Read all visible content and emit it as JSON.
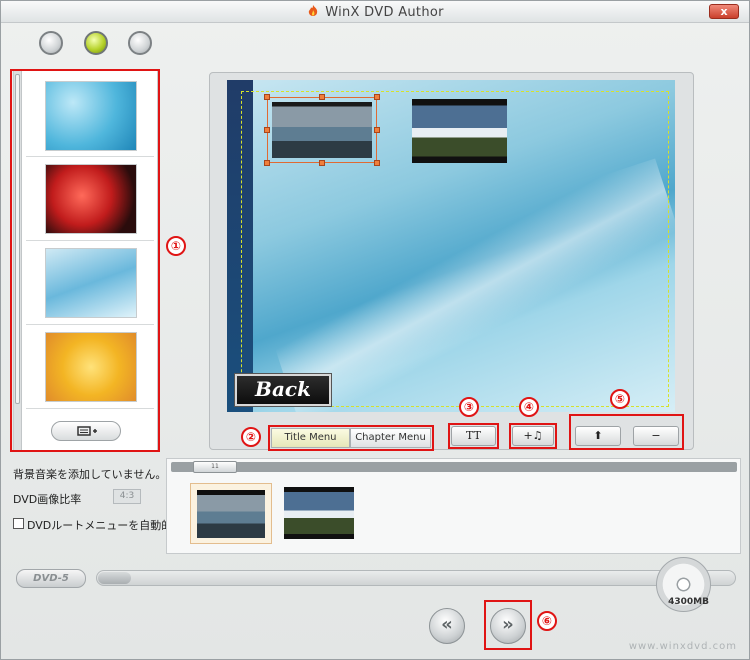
{
  "window": {
    "title": "WinX DVD Author",
    "close_label": "x"
  },
  "top_buttons": [
    "step-1",
    "step-2",
    "step-3"
  ],
  "template_panel": {
    "add_button_icon": "add-menu-icon",
    "thumbnails": [
      "blue-bubbles",
      "red-roses",
      "blue-wave",
      "yellow-flowers"
    ]
  },
  "preview": {
    "back_label": "Back"
  },
  "menu_tabs": [
    {
      "label": "Title Menu",
      "active": true
    },
    {
      "label": "Chapter Menu",
      "active": false
    }
  ],
  "tools": {
    "text_label": "TT",
    "music_label": "+♫",
    "up_label": "⬆",
    "minus_label": "−"
  },
  "info": {
    "music_status": "背景音楽を添加していません。",
    "ratio_label": "DVD画像比率",
    "ratio_value": "4:3",
    "auto_menu_label": "DVDルートメニューを自動的に添加する"
  },
  "timeline": {
    "thumb_label": "11"
  },
  "progress": {
    "dvd_type": "DVD-5",
    "capacity": "4300MB",
    "used_fraction": 0.03
  },
  "nav": {
    "prev_label": "«",
    "next_label": "»"
  },
  "annotations": [
    "①",
    "②",
    "③",
    "④",
    "⑤",
    "⑥"
  ],
  "footer": {
    "url": "www.winxdvd.com"
  }
}
